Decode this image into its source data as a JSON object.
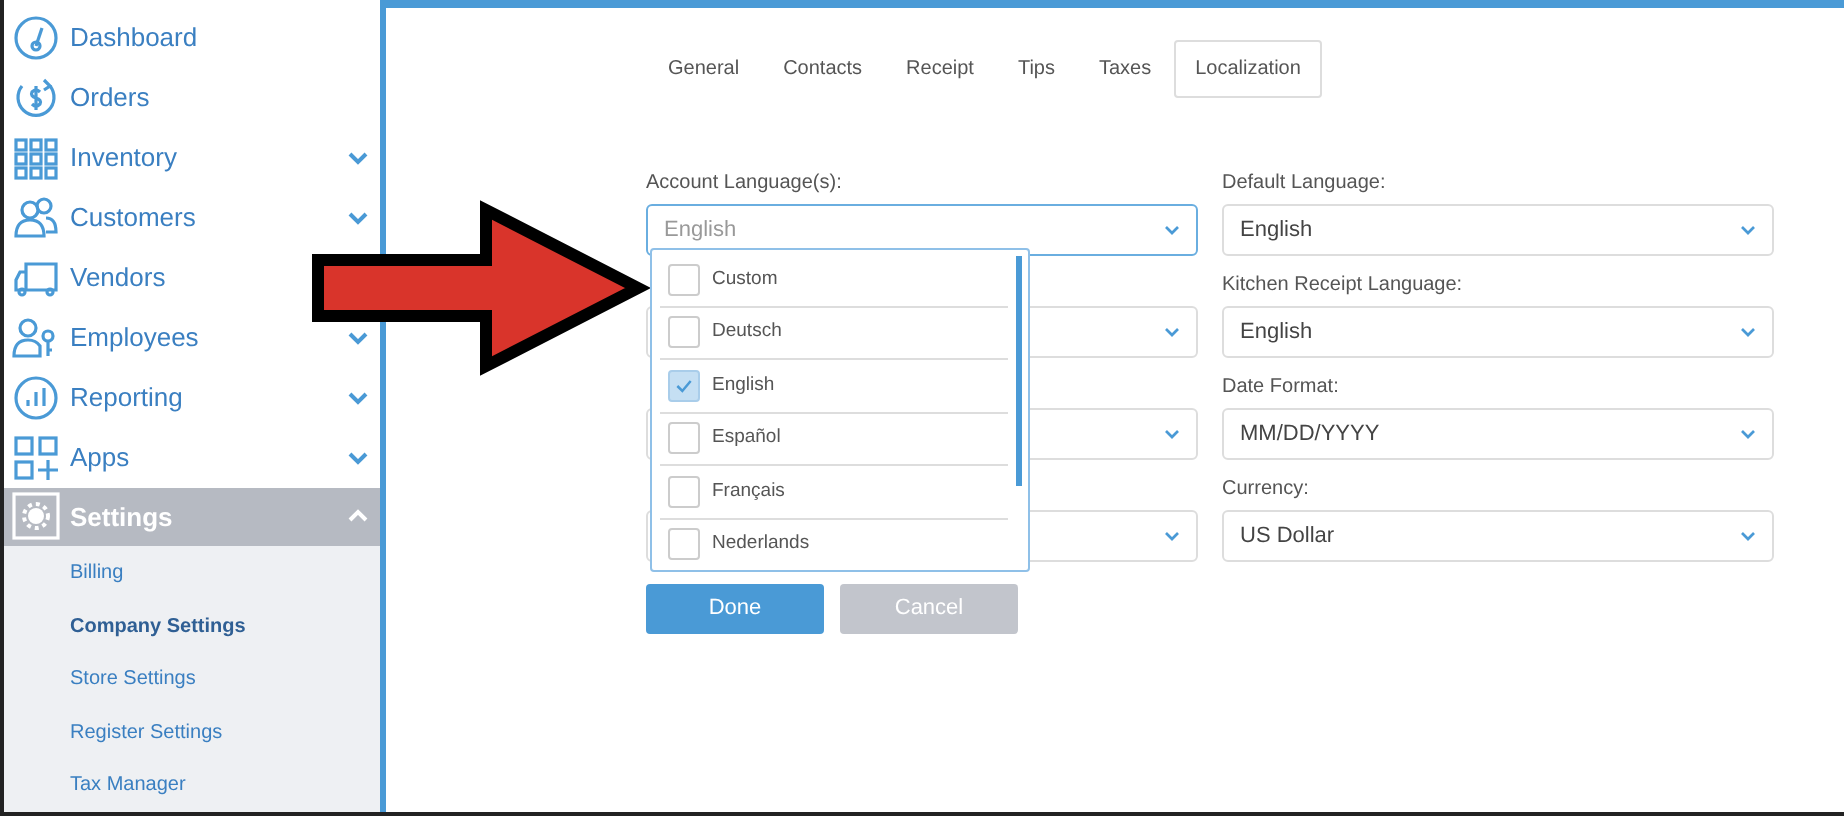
{
  "sidebar": {
    "items": [
      {
        "label": "Dashboard",
        "expandable": false,
        "expanded": false,
        "selected": false
      },
      {
        "label": "Orders",
        "expandable": false,
        "expanded": false,
        "selected": false
      },
      {
        "label": "Inventory",
        "expandable": true,
        "expanded": false,
        "selected": false
      },
      {
        "label": "Customers",
        "expandable": true,
        "expanded": false,
        "selected": false
      },
      {
        "label": "Vendors",
        "expandable": false,
        "expanded": false,
        "selected": false
      },
      {
        "label": "Employees",
        "expandable": true,
        "expanded": false,
        "selected": false
      },
      {
        "label": "Reporting",
        "expandable": true,
        "expanded": false,
        "selected": false
      },
      {
        "label": "Apps",
        "expandable": true,
        "expanded": false,
        "selected": false
      },
      {
        "label": "Settings",
        "expandable": true,
        "expanded": true,
        "selected": true,
        "children": [
          {
            "label": "Billing",
            "selected": false
          },
          {
            "label": "Company Settings",
            "selected": true
          },
          {
            "label": "Store Settings",
            "selected": false
          },
          {
            "label": "Register Settings",
            "selected": false
          },
          {
            "label": "Tax Manager",
            "selected": false
          }
        ]
      }
    ]
  },
  "tabs": [
    {
      "label": "General",
      "selected": false
    },
    {
      "label": "Contacts",
      "selected": false
    },
    {
      "label": "Receipt",
      "selected": false
    },
    {
      "label": "Tips",
      "selected": false
    },
    {
      "label": "Taxes",
      "selected": false
    },
    {
      "label": "Localization",
      "selected": true
    }
  ],
  "account_languages": {
    "label": "Account Language(s):",
    "value": "English",
    "expanded": true,
    "options": [
      {
        "label": "Custom",
        "checked": false
      },
      {
        "label": "Deutsch",
        "checked": false
      },
      {
        "label": "English",
        "checked": true
      },
      {
        "label": "Español",
        "checked": false
      },
      {
        "label": "Français",
        "checked": false
      },
      {
        "label": "Nederlands",
        "checked": false
      }
    ]
  },
  "right_fields": [
    {
      "label": "Default Language:",
      "value": "English"
    },
    {
      "label": "Kitchen Receipt Language:",
      "value": "English"
    },
    {
      "label": "Date Format:",
      "value": "MM/DD/YYYY"
    },
    {
      "label": "Currency:",
      "value": "US Dollar"
    }
  ],
  "buttons": [
    {
      "label": "Done",
      "kind": "primary"
    },
    {
      "label": "Cancel",
      "kind": "secondary"
    }
  ]
}
